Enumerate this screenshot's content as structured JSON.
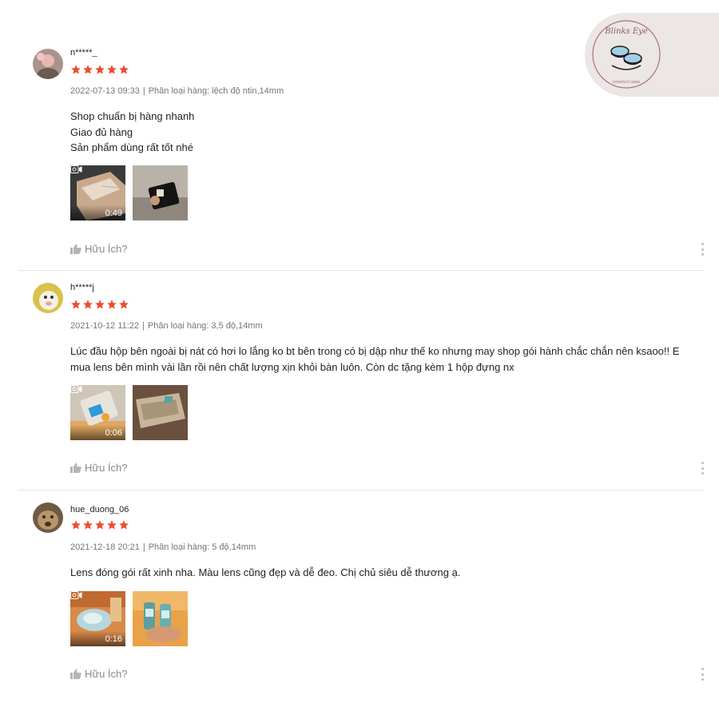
{
  "brand": {
    "logo_text": "Blinks Eye",
    "logo_subtext": "CONTACT LENS",
    "icon": "contact-lens-case-icon"
  },
  "colors": {
    "star": "#ee4d2d",
    "meta": "#757575",
    "divider": "#e6e6e6"
  },
  "reviews": [
    {
      "username": "n*****_",
      "rating": 5,
      "date": "2022-07-13 09:33",
      "variation_label": "Phân loại hàng: lệch độ ntin,14mm",
      "comment_lines": [
        "Shop chuẩn bị hàng nhanh",
        "Giao đủ hàng",
        "Sản phẩm dùng rất tốt nhé"
      ],
      "media": {
        "video_duration": "0:49"
      },
      "helpful_label": "Hữu Ích?"
    },
    {
      "username": "h*****j",
      "rating": 5,
      "date": "2021-10-12 11:22",
      "variation_label": "Phân loại hàng: 3,5 độ,14mm",
      "comment_lines": [
        "Lúc đầu hộp bên ngoài bị nát có hơi lo lắng ko bt bên trong có bị dập như thế ko nhưng may shop gói hành chắc chắn nên ksaoo!! E",
        "mua lens bên mình vài lần rồi nên chất lượng xịn khỏi bàn luôn. Còn dc tặng kèm 1 hộp đựng nx"
      ],
      "media": {
        "video_duration": "0:06"
      },
      "helpful_label": "Hữu Ích?"
    },
    {
      "username": "hue_duong_06",
      "rating": 5,
      "date": "2021-12-18 20:21",
      "variation_label": "Phân loại hàng: 5 độ,14mm",
      "comment_lines": [
        "Lens đóng gói rất xinh nha. Màu lens cũng đẹp và dễ đeo. Chị chủ siêu dễ thương ạ."
      ],
      "media": {
        "video_duration": "0:16"
      },
      "helpful_label": "Hữu Ích?"
    }
  ]
}
